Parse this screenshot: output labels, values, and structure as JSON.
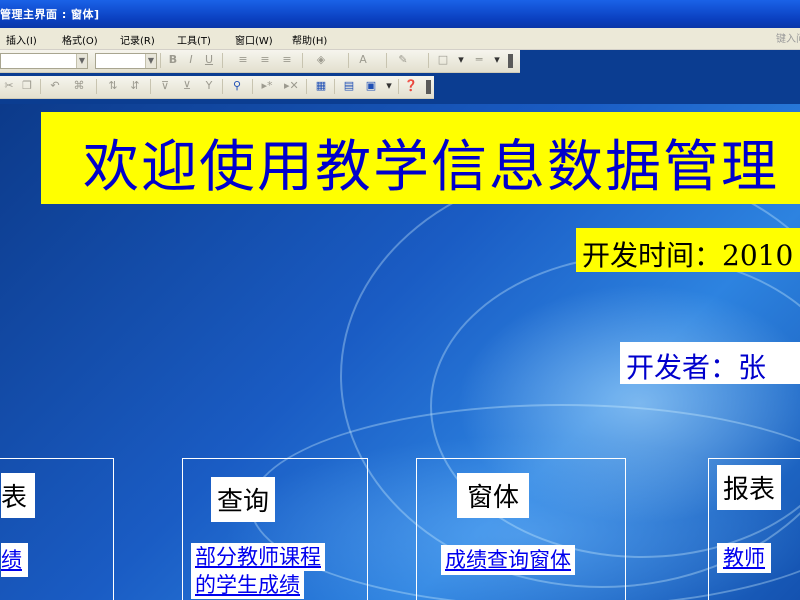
{
  "window": {
    "title": "管理主界面 : 窗体]"
  },
  "menu": {
    "items": [
      "插入(I)",
      "格式(O)",
      "记录(R)",
      "工具(T)",
      "窗口(W)",
      "帮助(H)"
    ],
    "help_placeholder": "键入问"
  },
  "toolbar": {
    "icons": [
      "bold-icon",
      "italic-icon",
      "underline-icon",
      "align-left-icon",
      "align-center-icon",
      "align-right-icon",
      "fill-color-icon",
      "font-color-icon",
      "line-color-icon",
      "border-icon",
      "line-width-icon",
      "undo-icon",
      "sort-asc-icon",
      "sort-desc-icon",
      "filter-icon",
      "find-icon",
      "properties-icon",
      "new-object-icon",
      "help-icon"
    ]
  },
  "form": {
    "banner": "欢迎使用教学信息数据管理",
    "dev_time": "开发时间：2010",
    "developer": "开发者：张",
    "panels": {
      "tables": {
        "caption": "表",
        "link": "绩"
      },
      "query": {
        "caption": "查询",
        "link_line1": "部分教师课程",
        "link_line2": "的学生成绩"
      },
      "form": {
        "caption": "窗体",
        "link": "成绩查询窗体"
      },
      "report": {
        "caption": "报表",
        "link": "教师"
      }
    }
  },
  "colors": {
    "banner_bg": "#ffff00",
    "banner_text": "#0000cc",
    "link": "#0000ee",
    "titlebar": "#0a3fbf"
  }
}
